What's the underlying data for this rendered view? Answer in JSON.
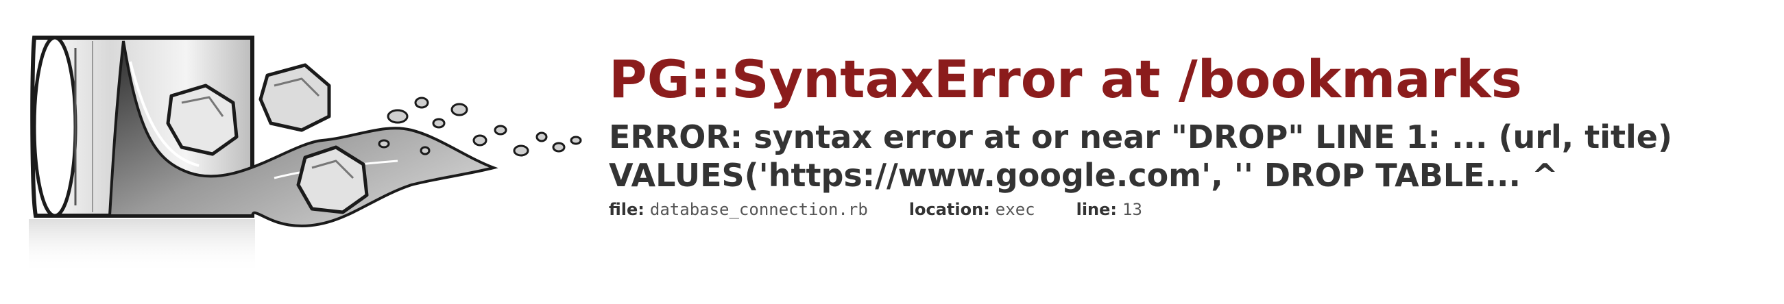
{
  "error": {
    "title": "PG::SyntaxError at /bookmarks",
    "message": "ERROR: syntax error at or near \"DROP\" LINE 1: ... (url, title) VALUES('https://www.google.com', '' DROP TABLE... ^"
  },
  "meta": {
    "file_label": "file:",
    "file_value": "database_connection.rb",
    "location_label": "location:",
    "location_value": "exec",
    "line_label": "line:",
    "line_value": "13"
  },
  "logo": {
    "icon": "spilled-glass-with-ice-cubes",
    "colors": {
      "outline": "#1a1a1a",
      "glass": "#e6e6e6",
      "liquid": "#8f8f8f"
    }
  },
  "colors": {
    "title": "#8b1c1c",
    "text": "#333333"
  }
}
